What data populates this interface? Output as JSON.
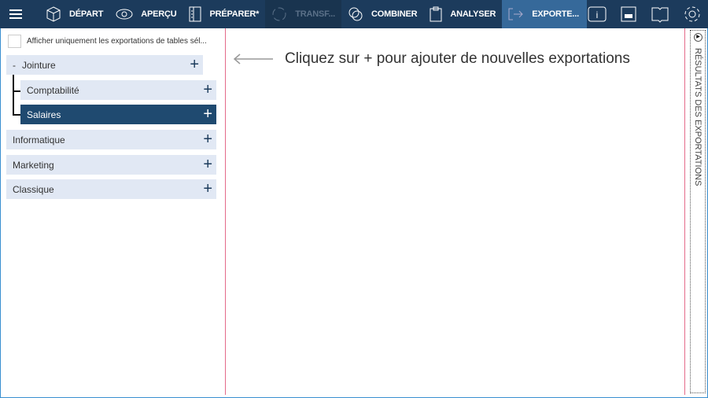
{
  "nav": {
    "items": [
      {
        "label": "DÉPART",
        "icon": "cube-icon"
      },
      {
        "label": "APERÇU",
        "icon": "eye-icon"
      },
      {
        "label": "PRÉPARER*",
        "icon": "columns-icon"
      },
      {
        "label": "TRANSF...",
        "icon": "transform-icon",
        "disabled": true
      },
      {
        "label": "COMBINER",
        "icon": "combine-icon"
      },
      {
        "label": "ANALYSER",
        "icon": "clipboard-icon"
      },
      {
        "label": "EXPORTE...",
        "icon": "export-icon",
        "active": true
      }
    ]
  },
  "left": {
    "checkbox_label": "Afficher uniquement les exportations de tables sél...",
    "tree": {
      "root": {
        "toggle": "-",
        "label": "Jointure"
      },
      "children": [
        "Comptabilité",
        "Salaires"
      ]
    },
    "others": [
      "Informatique",
      "Marketing",
      "Classique"
    ],
    "plus": "+"
  },
  "main": {
    "hint": "Cliquez sur + pour ajouter de nouvelles exportations"
  },
  "side": {
    "label": "RÉSULTATS DES EXPORTATIONS"
  }
}
